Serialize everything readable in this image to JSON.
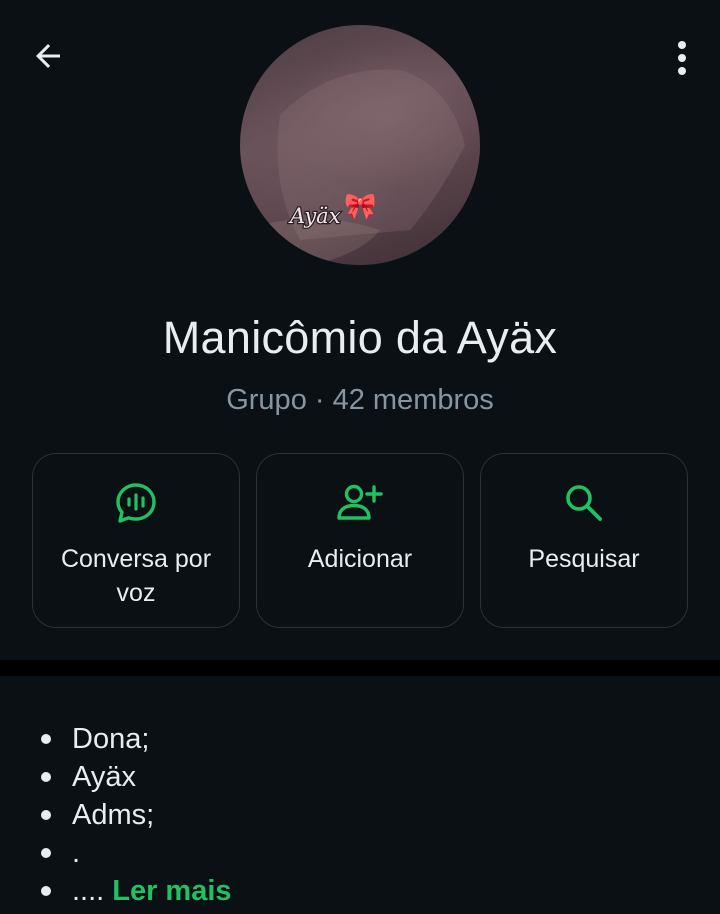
{
  "header": {
    "back_icon": "arrow-left-icon",
    "menu_icon": "more-vertical-icon"
  },
  "avatar": {
    "overlay_text": "Ayäx",
    "emoji": "🎀"
  },
  "group": {
    "name": "Manicômio da Ayäx",
    "subtitle": "Grupo · 42 membros"
  },
  "actions": [
    {
      "label": "Conversa por voz",
      "icon": "voice-chat-icon"
    },
    {
      "label": "Adicionar",
      "icon": "add-person-icon"
    },
    {
      "label": "Pesquisar",
      "icon": "search-icon"
    }
  ],
  "description": {
    "items": [
      "Dona;",
      "Ayäx",
      "Adms;",
      ".",
      "...."
    ],
    "read_more": "Ler mais"
  },
  "colors": {
    "background": "#0b1014",
    "accent": "#21c063",
    "text_primary": "#e9edef",
    "text_secondary": "#8696a0",
    "card_border": "#2a3338"
  }
}
